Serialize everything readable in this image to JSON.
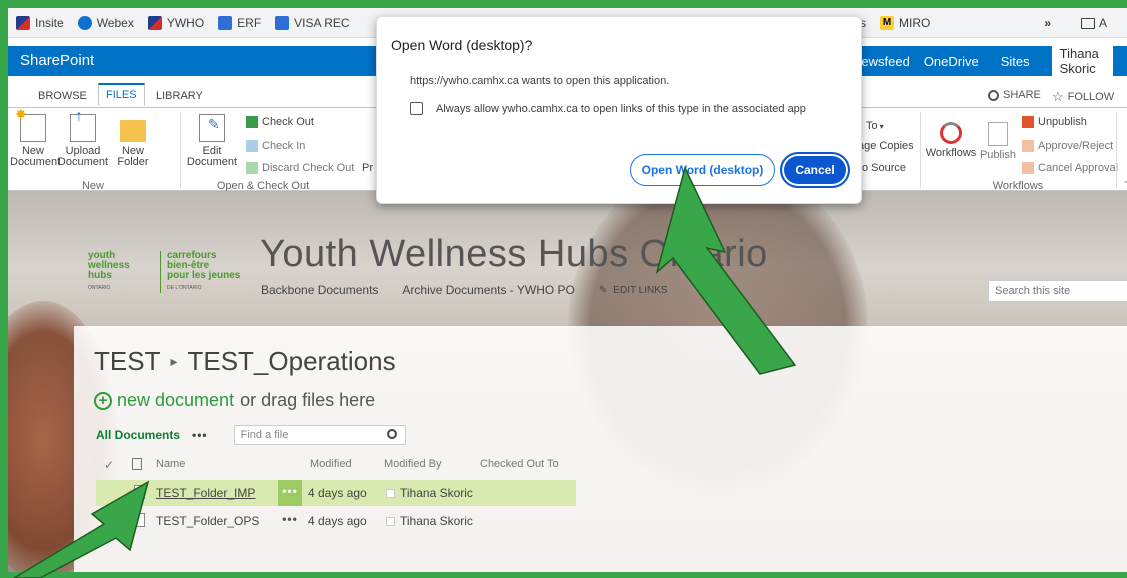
{
  "bookmarks": {
    "items": [
      "Insite",
      "Webex",
      "YWHO",
      "ERF",
      "VISA REC"
    ],
    "right_items": [
      "ms",
      "MIRO"
    ],
    "overflow": "»",
    "folder": "A"
  },
  "suite": {
    "brand": "SharePoint",
    "nav": [
      "Newsfeed",
      "OneDrive",
      "Sites"
    ],
    "user": "Tihana Skoric"
  },
  "ribbon": {
    "tabs": [
      "BROWSE",
      "FILES",
      "LIBRARY"
    ],
    "active_tab": "FILES",
    "right_actions": {
      "share": "SHARE",
      "follow": "FOLLOW"
    },
    "groups": {
      "new": {
        "label": "New",
        "new_document_line1": "New",
        "new_document_line2": "Document",
        "upload_line1": "Upload",
        "upload_line2": "Document",
        "new_folder_line1": "New",
        "new_folder_line2": "Folder"
      },
      "open_checkout": {
        "label": "Open & Check Out",
        "edit_line1": "Edit",
        "edit_line2": "Document",
        "check_out": "Check Out",
        "check_in": "Check In",
        "discard": "Discard Check Out",
        "partial": "Pr"
      },
      "copies": {
        "send_to": "To",
        "manage_copies": "age Copies",
        "go_to_source": "o Source"
      },
      "workflows": {
        "label": "Workflows",
        "workflows": "Workflows",
        "publish": "Publish",
        "unpublish": "Unpublish",
        "approve_reject": "Approve/Reject",
        "cancel_approval": "Cancel Approval"
      },
      "tags_partial": "Ta"
    }
  },
  "site": {
    "logo_en_line1": "youth",
    "logo_en_line2": "wellness",
    "logo_en_line3": "hubs",
    "logo_en_sub": "ONTARIO",
    "logo_fr_line1": "carrefours",
    "logo_fr_line2": "bien-être",
    "logo_fr_line3": "pour les jeunes",
    "logo_fr_sub": "DE L'ONTARIO",
    "title": "Youth Wellness Hubs Ontario",
    "nav": [
      "Backbone Documents",
      "Archive Documents - YWHO PO"
    ],
    "edit_links": "EDIT LINKS",
    "search_placeholder": "Search this site"
  },
  "library": {
    "breadcrumb": [
      "TEST",
      "TEST_Operations"
    ],
    "breadcrumb_sep": "▸",
    "new_document": "new document",
    "drag_text": "or drag files here",
    "view": "All Documents",
    "view_more": "•••",
    "find_placeholder": "Find a file",
    "columns": [
      "Name",
      "Modified",
      "Modified By",
      "Checked Out To"
    ],
    "rows": [
      {
        "name": "TEST_Folder_IMP",
        "modified": "4 days ago",
        "modified_by": "Tihana Skoric",
        "selected": true
      },
      {
        "name": "TEST_Folder_OPS",
        "modified": "4 days ago",
        "modified_by": "Tihana Skoric",
        "selected": false
      }
    ]
  },
  "dialog": {
    "title": "Open Word (desktop)?",
    "message": "https://ywho.camhx.ca wants to open this application.",
    "checkbox_label": "Always allow ywho.camhx.ca to open links of this type in the associated app",
    "open_button": "Open Word (desktop)",
    "cancel_button": "Cancel"
  },
  "colors": {
    "border_green": "#3aa64a",
    "suite_blue": "#0072c6",
    "accent_green": "#2a9d3a",
    "dialog_blue": "#0b57d0"
  }
}
